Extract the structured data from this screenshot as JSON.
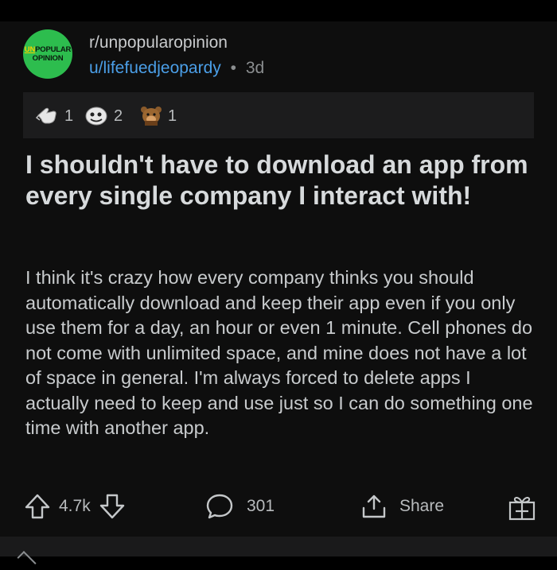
{
  "post": {
    "subreddit": "r/unpopularopinion",
    "avatar": {
      "line1_prefix": "UN",
      "line1_rest": "POPULAR",
      "line2": "OPINION",
      "color": "#2dbd4e"
    },
    "username": "u/lifefuedjeopardy",
    "separator": "•",
    "age": "3d",
    "awards": [
      {
        "icon": "hand-award-icon",
        "count": "1"
      },
      {
        "icon": "face-award-icon",
        "count": "2"
      },
      {
        "icon": "bear-award-icon",
        "count": "1"
      }
    ],
    "title": "I shouldn't have to download an app from every single company I interact with!",
    "body": "I think it's crazy how every company thinks you should automatically download and keep their app even if you only use them for a day, an hour or even 1 minute. Cell phones do not come with unlimited space, and mine does not have a lot of space in general. I'm always forced to delete apps I actually need to keep and use just so I can do something one time with another app."
  },
  "actions": {
    "votes": "4.7k",
    "comments": "301",
    "share_label": "Share"
  },
  "colors": {
    "background": "#0e0e0e",
    "text": "#d7dadc",
    "username": "#4b9fe8",
    "muted": "#8b8e90"
  }
}
